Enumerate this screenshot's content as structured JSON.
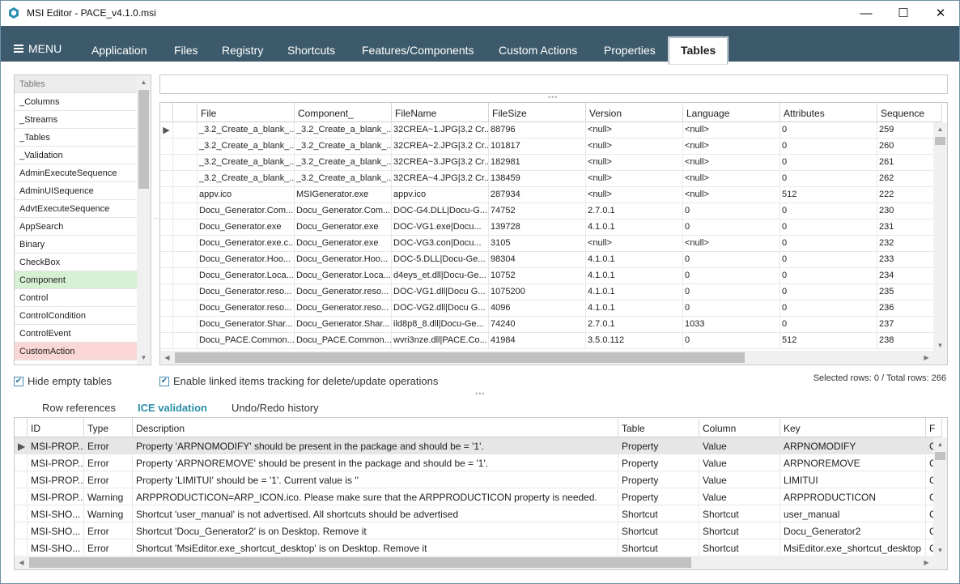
{
  "window": {
    "title": "MSI Editor - PACE_v4.1.0.msi",
    "controls": [
      "—",
      "☐",
      "✕"
    ]
  },
  "menubar": {
    "menu_label": "MENU",
    "tabs": [
      "Application",
      "Files",
      "Registry",
      "Shortcuts",
      "Features/Components",
      "Custom Actions",
      "Properties",
      "Tables"
    ],
    "active_tab": "Tables"
  },
  "tables_panel": {
    "header": "Tables",
    "items": [
      "_Columns",
      "_Streams",
      "_Tables",
      "_Validation",
      "AdminExecuteSequence",
      "AdminUISequence",
      "AdvtExecuteSequence",
      "AppSearch",
      "Binary",
      "CheckBox",
      "Component",
      "Control",
      "ControlCondition",
      "ControlEvent",
      "CustomAction"
    ],
    "highlighted_green": "Component",
    "highlighted_red": "CustomAction"
  },
  "search": {
    "placeholder": ""
  },
  "main_grid": {
    "columns": [
      "File",
      "Component_",
      "FileName",
      "FileSize",
      "Version",
      "Language",
      "Attributes",
      "Sequence"
    ],
    "rows": [
      [
        "_3.2_Create_a_blank_...",
        "_3.2_Create_a_blank_...",
        "32CREA~1.JPG|3.2 Cr...",
        "88796",
        "<null>",
        "<null>",
        "0",
        "259"
      ],
      [
        "_3.2_Create_a_blank_...",
        "_3.2_Create_a_blank_...",
        "32CREA~2.JPG|3.2 Cr...",
        "101817",
        "<null>",
        "<null>",
        "0",
        "260"
      ],
      [
        "_3.2_Create_a_blank_...",
        "_3.2_Create_a_blank_...",
        "32CREA~3.JPG|3.2 Cr...",
        "182981",
        "<null>",
        "<null>",
        "0",
        "261"
      ],
      [
        "_3.2_Create_a_blank_...",
        "_3.2_Create_a_blank_...",
        "32CREA~4.JPG|3.2 Cr...",
        "138459",
        "<null>",
        "<null>",
        "0",
        "262"
      ],
      [
        "appv.ico",
        "MSIGenerator.exe",
        "appv.ico",
        "287934",
        "<null>",
        "<null>",
        "512",
        "222"
      ],
      [
        "Docu_Generator.Com...",
        "Docu_Generator.Com...",
        "DOC-G4.DLL|Docu-G...",
        "74752",
        "2.7.0.1",
        "0",
        "0",
        "230"
      ],
      [
        "Docu_Generator.exe",
        "Docu_Generator.exe",
        "DOC-VG1.exe|Docu...",
        "139728",
        "4.1.0.1",
        "0",
        "0",
        "231"
      ],
      [
        "Docu_Generator.exe.c...",
        "Docu_Generator.exe",
        "DOC-VG3.con|Docu...",
        "3105",
        "<null>",
        "<null>",
        "0",
        "232"
      ],
      [
        "Docu_Generator.Hoo...",
        "Docu_Generator.Hoo...",
        "DOC-5.DLL|Docu-Ge...",
        "98304",
        "4.1.0.1",
        "0",
        "0",
        "233"
      ],
      [
        "Docu_Generator.Loca...",
        "Docu_Generator.Loca...",
        "d4eys_et.dll|Docu-Ge...",
        "10752",
        "4.1.0.1",
        "0",
        "0",
        "234"
      ],
      [
        "Docu_Generator.reso...",
        "Docu_Generator.reso...",
        "DOC-VG1.dll|Docu G...",
        "1075200",
        "4.1.0.1",
        "0",
        "0",
        "235"
      ],
      [
        "Docu_Generator.reso...",
        "Docu_Generator.reso...",
        "DOC-VG2.dll|Docu G...",
        "4096",
        "4.1.0.1",
        "0",
        "0",
        "236"
      ],
      [
        "Docu_Generator.Shar...",
        "Docu_Generator.Shar...",
        "ild8p8_8.dll|Docu-Ge...",
        "74240",
        "2.7.0.1",
        "1033",
        "0",
        "237"
      ],
      [
        "Docu_PACE.Common...",
        "Docu_PACE.Common...",
        "wvri3nze.dll|PACE.Co...",
        "41984",
        "3.5.0.112",
        "0",
        "512",
        "238"
      ]
    ]
  },
  "options": {
    "hide_empty": "Hide empty tables",
    "linked_tracking": "Enable linked items tracking for delete/update operations",
    "row_info": "Selected rows: 0 / Total rows: 266"
  },
  "bottom_tabs": [
    "Row references",
    "ICE validation",
    "Undo/Redo history"
  ],
  "bottom_active": "ICE validation",
  "ice_grid": {
    "columns": [
      "ID",
      "Type",
      "Description",
      "Table",
      "Column",
      "Key",
      "F"
    ],
    "rows": [
      [
        "MSI-PROP...",
        "Error",
        "Property 'ARPNOMODIFY' should be present in the package and should be = '1'.",
        "Property",
        "Value",
        "ARPNOMODIFY",
        "C"
      ],
      [
        "MSI-PROP...",
        "Error",
        "Property 'ARPNOREMOVE' should be present in the package and should be = '1'.",
        "Property",
        "Value",
        "ARPNOREMOVE",
        "C"
      ],
      [
        "MSI-PROP...",
        "Error",
        "Property 'LIMITUI' should be = '1'. Current value is ''",
        "Property",
        "Value",
        "LIMITUI",
        "C"
      ],
      [
        "MSI-PROP...",
        "Warning",
        "ARPPRODUCTICON=ARP_ICON.ico. Please make sure that the ARPPRODUCTICON property is needed.",
        "Property",
        "Value",
        "ARPPRODUCTICON",
        "C"
      ],
      [
        "MSI-SHO...",
        "Warning",
        "Shortcut 'user_manual' is not advertised. All shortcuts should be advertised",
        "Shortcut",
        "Shortcut",
        "user_manual",
        "C"
      ],
      [
        "MSI-SHO...",
        "Error",
        "Shortcut 'Docu_Generator2' is on Desktop. Remove it",
        "Shortcut",
        "Shortcut",
        "Docu_Generator2",
        "C"
      ],
      [
        "MSI-SHO...",
        "Error",
        "Shortcut 'MsiEditor.exe_shortcut_desktop' is on Desktop. Remove it",
        "Shortcut",
        "Shortcut",
        "MsiEditor.exe_shortcut_desktop",
        "C"
      ]
    ]
  }
}
